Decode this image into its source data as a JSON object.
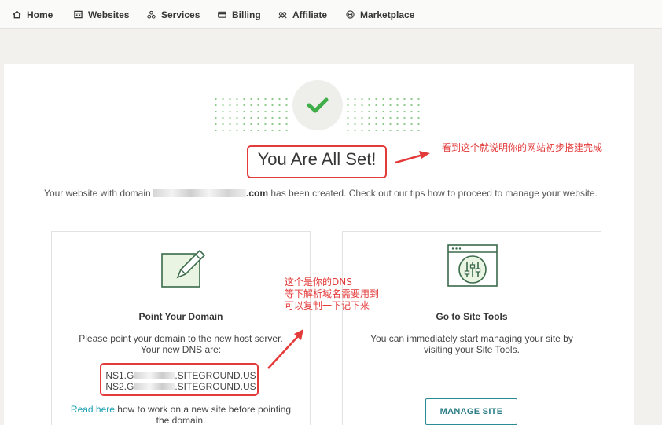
{
  "nav": {
    "items": [
      {
        "label": "Home",
        "icon": "home-icon"
      },
      {
        "label": "Websites",
        "icon": "websites-icon"
      },
      {
        "label": "Services",
        "icon": "services-icon"
      },
      {
        "label": "Billing",
        "icon": "billing-icon"
      },
      {
        "label": "Affiliate",
        "icon": "affiliate-icon"
      },
      {
        "label": "Marketplace",
        "icon": "marketplace-icon"
      }
    ]
  },
  "success": {
    "icon": "check-icon",
    "title": "You Are All Set!",
    "desc_before": "Your website with domain ",
    "desc_domain_suffix": ".com",
    "desc_after": " has been created. Check out our tips how to proceed to manage your website."
  },
  "point_domain": {
    "icon": "edit-icon",
    "title": "Point Your Domain",
    "text_line1": "Please point your domain to the new host server.",
    "text_line2": "Your new DNS are:",
    "ns1_prefix": "NS1.G",
    "ns1_suffix": ".SITEGROUND.US",
    "ns2_prefix": "NS2.G",
    "ns2_suffix": ".SITEGROUND.US",
    "read_link": "Read here",
    "read_rest": " how to work on a new site before pointing the domain."
  },
  "site_tools": {
    "icon": "site-tools-icon",
    "title": "Go to Site Tools",
    "text": "You can immediately start managing your site by visiting your Site Tools.",
    "button": "MANAGE SITE"
  },
  "annotations": {
    "title_note": "看到这个就说明你的网站初步搭建完成",
    "dns_note_line1": "这个是你的DNS",
    "dns_note_line2": "等下解析域名需要用到",
    "dns_note_line3": "可以复制一下记下来",
    "color": "#e33a3a"
  },
  "colors": {
    "accent": "#2c8c95",
    "check": "#3fae49",
    "link": "#1a9eb0"
  }
}
